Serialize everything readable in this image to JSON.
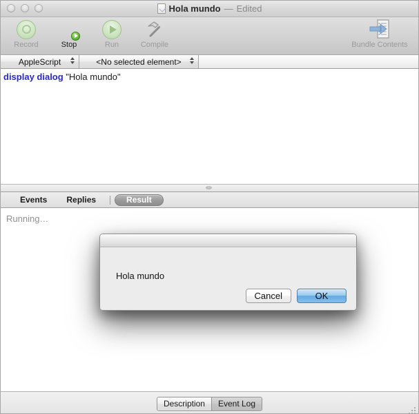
{
  "window": {
    "title": "Hola mundo",
    "title_separator": "—",
    "edited_label": "Edited",
    "doc_icon": "applescript-document-icon",
    "traffic_lights": [
      {
        "name": "close-button",
        "label": "close"
      },
      {
        "name": "minimize-button",
        "label": "minimize"
      },
      {
        "name": "zoom-button",
        "label": "zoom"
      }
    ]
  },
  "toolbar": {
    "items": [
      {
        "label": "Record",
        "icon": "record-icon",
        "enabled": false
      },
      {
        "label": "Stop",
        "icon": "stop-icon",
        "enabled": true
      },
      {
        "label": "Run",
        "icon": "run-icon",
        "enabled": false
      },
      {
        "label": "Compile",
        "icon": "hammer-icon",
        "enabled": false
      }
    ],
    "bundle_contents": {
      "label": "Bundle Contents",
      "icon": "bundle-contents-icon",
      "enabled": false
    }
  },
  "navbar": {
    "language_popup": {
      "value": "AppleScript"
    },
    "element_popup": {
      "value": "<No selected element>"
    }
  },
  "editor": {
    "lines": [
      {
        "keyword": "display dialog ",
        "string": "\"Hola mundo\""
      }
    ]
  },
  "result_tabs": {
    "tabs": [
      {
        "label": "Events",
        "selected": false
      },
      {
        "label": "Replies",
        "selected": false
      },
      {
        "label": "Result",
        "selected": true
      }
    ]
  },
  "result_pane": {
    "status": "Running…"
  },
  "bottom_bar": {
    "segments": [
      {
        "label": "Description",
        "active": false
      },
      {
        "label": "Event Log",
        "active": true
      }
    ]
  },
  "dialog": {
    "message": "Hola mundo",
    "buttons": [
      {
        "label": "Cancel",
        "default": false
      },
      {
        "label": "OK",
        "default": true
      }
    ]
  },
  "colors": {
    "accent_blue": "#62a9e3",
    "keyword_blue": "#2727cf",
    "stop_red": "#e02a1c",
    "run_green": "#b6d6a8",
    "status_gray": "#8f8f8f"
  }
}
